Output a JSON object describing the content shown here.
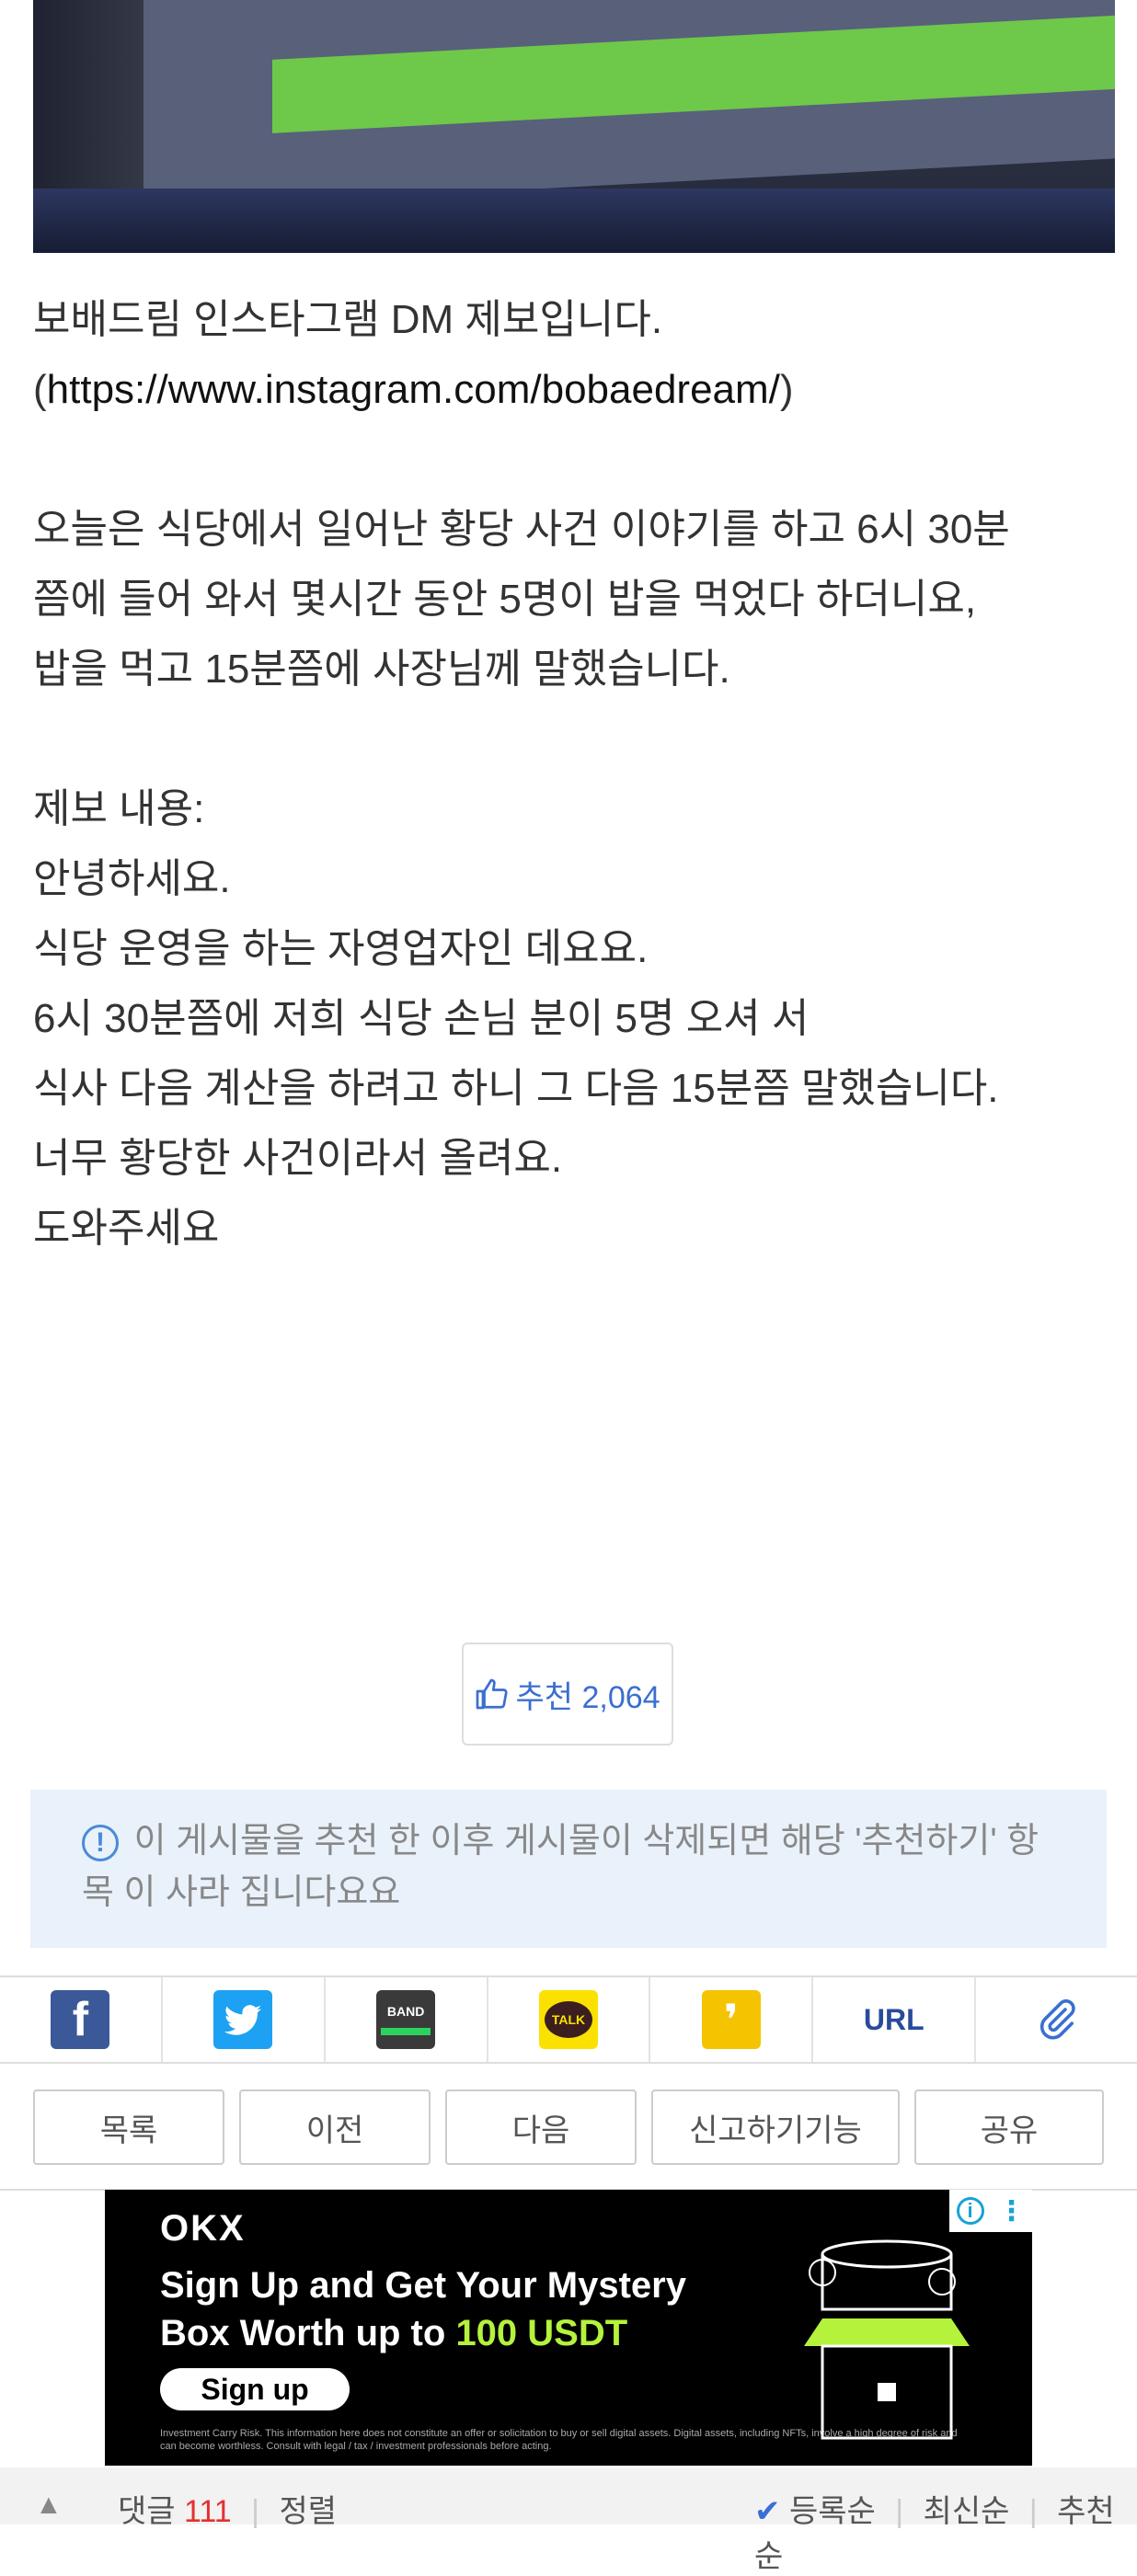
{
  "post": {
    "lines": [
      "보배드림 인스타그램 DM 제보입니다.",
      "",
      "",
      "오늘은 식당에서 일어난 황당 사건 이야기를 하고 6시 30분",
      "쯤에 들어 와서 몇시간 동안 5명이 밥을 먹었다 하더니요,",
      "밥을 먹고 15분쯤에 사장님께 말했습니다.",
      "",
      "제보 내용:",
      "안녕하세요.",
      "식당 운영을 하는 자영업자인 데요요.",
      "6시 30분쯤에 저희 식당 손님 분이 5명 오셔 서",
      "식사 다음 계산을 하려고 하니 그 다음 15분쯤 말했습니다.",
      "너무 황당한 사건이라서 올려요.",
      "도와주세요"
    ],
    "link_prefix": "(",
    "link_url": "https://www.instagram.com/bobaedream/",
    "link_suffix": ")"
  },
  "like": {
    "label": "추천 2,064"
  },
  "notice": {
    "text": "이 게시물을 추천 한 이후 게시물이 삭제되면 해당 '추천하기' 항목 이 사라 집니다요요"
  },
  "share": {
    "items": [
      {
        "name": "facebook",
        "glyph": "f"
      },
      {
        "name": "twitter",
        "glyph": ""
      },
      {
        "name": "band",
        "glyph": "BAND"
      },
      {
        "name": "kakaotalk",
        "glyph": "TALK"
      },
      {
        "name": "kakaostory",
        "glyph": "❜"
      },
      {
        "name": "url",
        "glyph": "URL"
      },
      {
        "name": "attach",
        "glyph": "⌀"
      }
    ]
  },
  "actions": {
    "buttons": [
      "목록",
      "이전",
      "다음",
      "신고하기기능",
      "공유"
    ]
  },
  "ad": {
    "brand": "OKX",
    "headline_line1": "Sign Up and Get Your Mystery",
    "headline_line2_prefix": "Box Worth up to ",
    "headline_highlight": "100 USDT",
    "cta": "Sign up",
    "disclaimer": "Investment Carry Risk. This information here does not constitute an offer or solicitation to buy or sell digital assets. Digital assets, including NFTs, involve a high degree of risk and can become worthless. Consult with legal / tax / investment professionals before acting.",
    "colors": {
      "accent": "#b4f23c",
      "background": "#000000"
    }
  },
  "footer": {
    "up_icon": "caret-up-icon",
    "comments_label": "댓글",
    "comments_count": "111",
    "sort_label": "정렬",
    "right_items": [
      "등록순",
      "최신순",
      "추천순"
    ]
  }
}
